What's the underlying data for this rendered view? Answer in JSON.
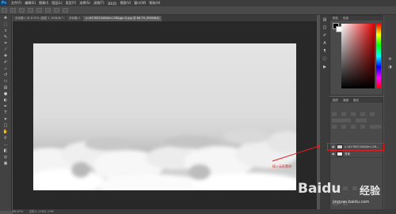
{
  "app": {
    "logo": "Ps"
  },
  "menu": [
    "文件(F)",
    "编辑(E)",
    "图像(I)",
    "图层(L)",
    "类型(Y)",
    "选择(S)",
    "滤镜(T)",
    "3D(D)",
    "视图(V)",
    "窗口(W)",
    "帮助(H)"
  ],
  "tabs": [
    {
      "label": "未标题-1 @ 8.33% (图层 1, RGB/8) *"
    },
    {
      "label": "未标题-2"
    },
    {
      "label": "u=617652340&fm=26&gp=0.jpg @ 66.7% (RGB/8#)"
    }
  ],
  "panels": {
    "color_tabs": [
      "颜色",
      "色板"
    ],
    "layers_tabs": [
      "图层",
      "通道",
      "路径"
    ]
  },
  "layers": [
    {
      "name": "u=617652340&fm=26..."
    },
    {
      "name": "背景"
    }
  ],
  "annotation": "插入云彩素材",
  "status": {
    "zoom": "66.67%",
    "doc": "文档:1.17M/1.17M"
  },
  "watermark": {
    "brand": "Baidu",
    "cn": "经验",
    "url": "jingyan.baidu.com"
  },
  "colors": {
    "accent": "#e02020",
    "fg": "#000000",
    "bg": "#ffffff"
  }
}
